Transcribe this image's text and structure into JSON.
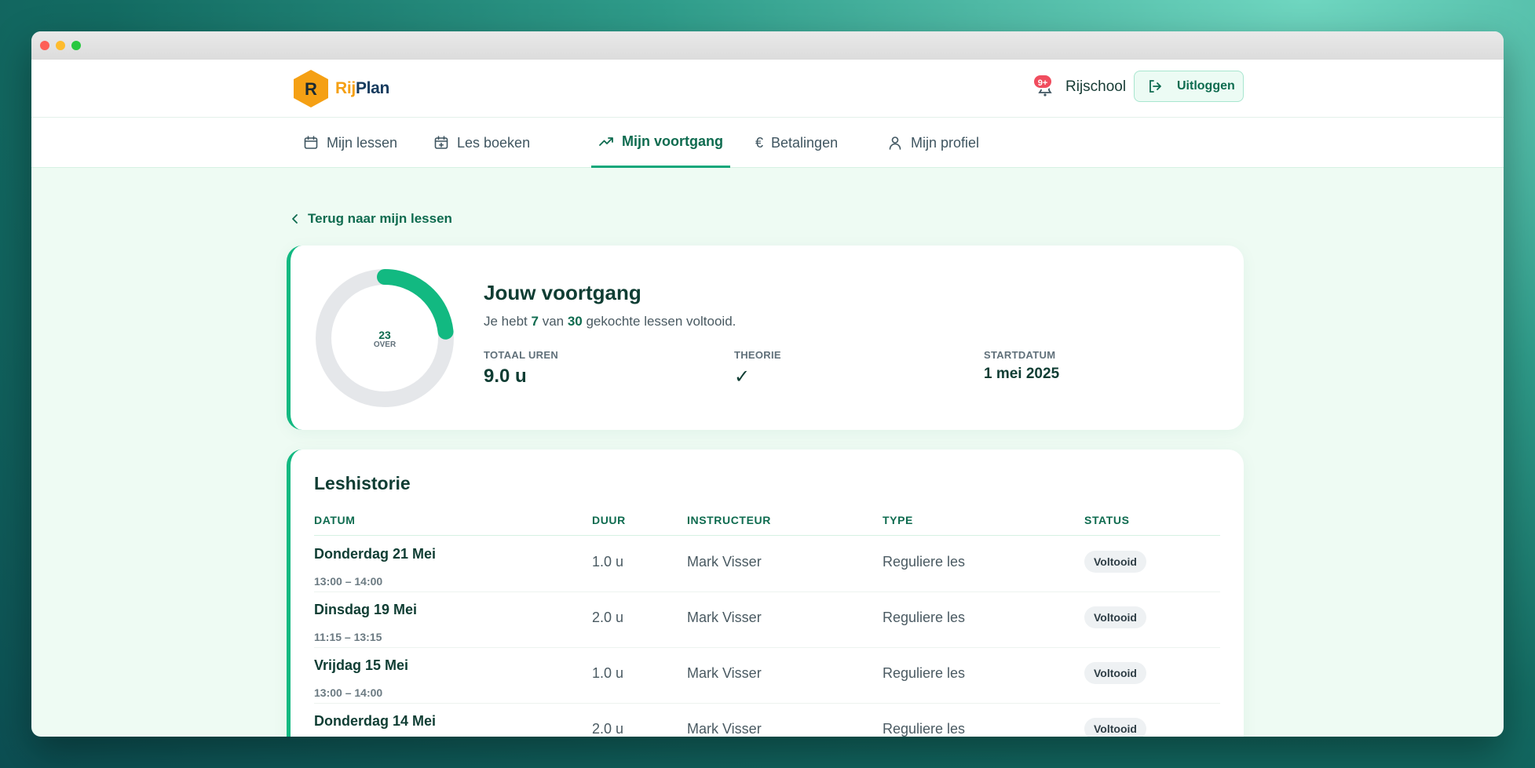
{
  "app": {
    "brand_part1": "Rij",
    "brand_part2": "Plan",
    "logo_letter": "R"
  },
  "header": {
    "notification_badge": "9+",
    "school_name": "Rijschool",
    "logout_label": "Uitloggen"
  },
  "nav": {
    "items": [
      {
        "label": "Mijn lessen",
        "icon": "calendar-icon"
      },
      {
        "label": "Les boeken",
        "icon": "calendar-plus-icon"
      },
      {
        "label": "Mijn voortgang",
        "icon": "trending-up-icon",
        "active": true
      },
      {
        "label": "Betalingen",
        "icon": "euro-icon"
      },
      {
        "label": "Mijn profiel",
        "icon": "user-icon"
      }
    ]
  },
  "back_link": "Terug naar mijn lessen",
  "progress": {
    "title": "Jouw voortgang",
    "subtitle_pre": "Je hebt ",
    "completed": "7",
    "subtitle_mid": " van ",
    "total": "30",
    "subtitle_post": " gekochte lessen voltooid.",
    "ring_value": "23",
    "ring_label": "OVER",
    "ring_fraction": 0.233,
    "stats": [
      {
        "label": "TOTAAL UREN",
        "value": "9.0 u"
      },
      {
        "label": "THEORIE",
        "value": "✓"
      },
      {
        "label": "STARTDATUM",
        "value": "1 mei 2025"
      }
    ]
  },
  "history": {
    "title": "Leshistorie",
    "columns": [
      "DATUM",
      "DUUR",
      "INSTRUCTEUR",
      "TYPE",
      "STATUS"
    ],
    "rows": [
      {
        "date": "Donderdag 21 Mei",
        "time": "13:00 – 14:00",
        "duration": "1.0 u",
        "instructor": "Mark Visser",
        "type": "Reguliere les",
        "status": "Voltooid"
      },
      {
        "date": "Dinsdag 19 Mei",
        "time": "11:15 – 13:15",
        "duration": "2.0 u",
        "instructor": "Mark Visser",
        "type": "Reguliere les",
        "status": "Voltooid"
      },
      {
        "date": "Vrijdag 15 Mei",
        "time": "13:00 – 14:00",
        "duration": "1.0 u",
        "instructor": "Mark Visser",
        "type": "Reguliere les",
        "status": "Voltooid"
      },
      {
        "date": "Donderdag 14 Mei",
        "time": "",
        "duration": "2.0 u",
        "instructor": "Mark Visser",
        "type": "Reguliere les",
        "status": "Voltooid"
      }
    ]
  },
  "colors": {
    "accent": "#12b981",
    "brand_orange": "#f5a014",
    "dark_green": "#0e6b4f",
    "page_bg": "#eefbf3"
  }
}
